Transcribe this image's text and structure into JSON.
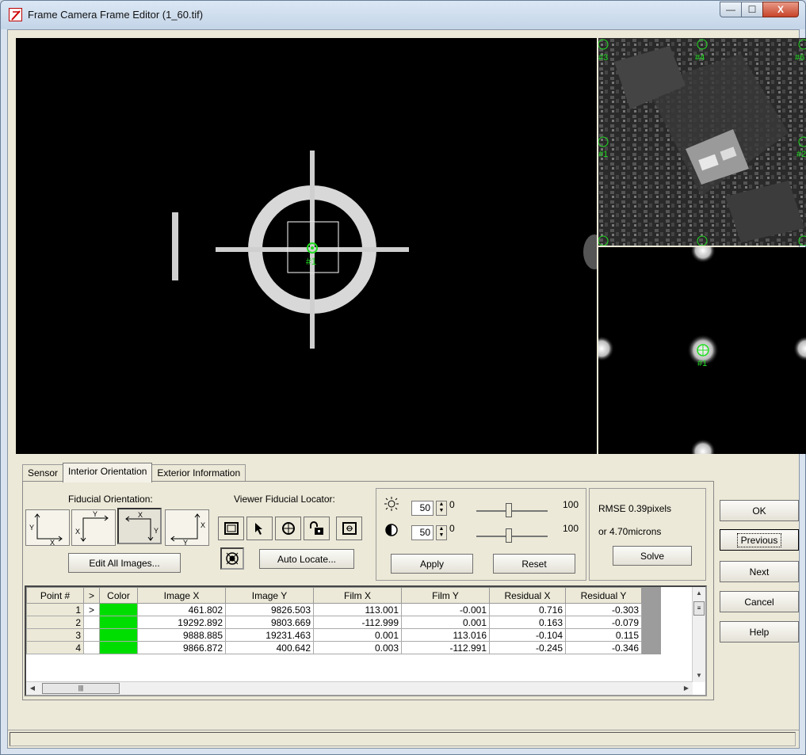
{
  "window": {
    "title": "Frame Camera Frame Editor (1_60.tif)",
    "controls": {
      "minimize": "—",
      "maximize": "☐",
      "close": "X"
    }
  },
  "viewers": {
    "main_marker_label": "#1",
    "overview_labels": [
      "#3",
      "#4",
      "#6",
      "#2",
      "#1"
    ],
    "zoom_marker_label": "#1",
    "marker_color": "#22dd22"
  },
  "tabs": [
    "Sensor",
    "Interior Orientation",
    "Exterior Information"
  ],
  "active_tab": "Interior Orientation",
  "fiducial": {
    "label": "Fiducial Orientation:",
    "edit_all_label": "Edit All Images..."
  },
  "locator": {
    "label": "Viewer Fiducial Locator:",
    "auto_locate_label": "Auto Locate..."
  },
  "adjust": {
    "brightness_value": "50",
    "contrast_value": "50",
    "min": "0",
    "max": "100",
    "apply_label": "Apply",
    "reset_label": "Reset"
  },
  "rmse": {
    "line1": "RMSE 0.39pixels",
    "line2": "or 4.70microns",
    "solve_label": "Solve"
  },
  "side_buttons": {
    "ok": "OK",
    "previous": "Previous",
    "next": "Next",
    "cancel": "Cancel",
    "help": "Help"
  },
  "table": {
    "columns": [
      "Point #",
      ">",
      "Color",
      "Image X",
      "Image Y",
      "Film X",
      "Film Y",
      "Residual X",
      "Residual Y"
    ],
    "rows": [
      {
        "point": "1",
        "cur": ">",
        "color": "#00dd00",
        "image_x": "461.802",
        "image_y": "9826.503",
        "film_x": "113.001",
        "film_y": "-0.001",
        "res_x": "0.716",
        "res_y": "-0.303"
      },
      {
        "point": "2",
        "cur": "",
        "color": "#00dd00",
        "image_x": "19292.892",
        "image_y": "9803.669",
        "film_x": "-112.999",
        "film_y": "0.001",
        "res_x": "0.163",
        "res_y": "-0.079"
      },
      {
        "point": "3",
        "cur": "",
        "color": "#00dd00",
        "image_x": "9888.885",
        "image_y": "19231.463",
        "film_x": "0.001",
        "film_y": "113.016",
        "res_x": "-0.104",
        "res_y": "0.115"
      },
      {
        "point": "4",
        "cur": "",
        "color": "#00dd00",
        "image_x": "9866.872",
        "image_y": "400.642",
        "film_x": "0.003",
        "film_y": "-112.991",
        "res_x": "-0.245",
        "res_y": "-0.346"
      }
    ]
  }
}
